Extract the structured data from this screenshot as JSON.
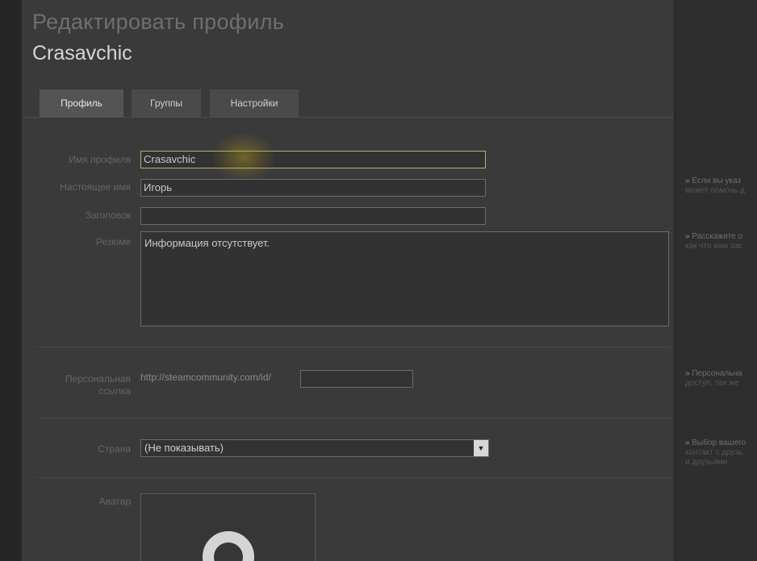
{
  "header": {
    "title": "Редактировать профиль",
    "username": "Crasavchic"
  },
  "tabs": [
    {
      "label": "Профиль",
      "active": true
    },
    {
      "label": "Группы",
      "active": false
    },
    {
      "label": "Настройки",
      "active": false
    }
  ],
  "form": {
    "profile_name": {
      "label": "Имя профиля",
      "value": "Crasavchic"
    },
    "real_name": {
      "label": "Настоящее имя",
      "value": "Игорь"
    },
    "headline": {
      "label": "Заголовок",
      "value": ""
    },
    "summary": {
      "label": "Резюме",
      "value": "Информация отсутствует."
    },
    "custom_url": {
      "label_line1": "Персональная",
      "label_line2": "ссылка",
      "prefix": "http://steamcommunity.com/id/",
      "value": ""
    },
    "country": {
      "label": "Страна",
      "selected": "(Не показывать)"
    },
    "avatar": {
      "label": "Аватар"
    }
  },
  "hints": [
    {
      "line1": "Если вы указ",
      "line2": "может помочь д"
    },
    {
      "line1": "Расскажите о",
      "line2": "как что вам зас"
    },
    {
      "line1": "Персональна",
      "line2": "доступ, так же"
    },
    {
      "line1": "Выбор вашего",
      "line2": "контакт с друзь",
      "line3": "и друзьями."
    }
  ],
  "icons": {
    "hint_bullet": "»",
    "select_arrow": "▼"
  },
  "colors": {
    "focus_border": "#bdb060",
    "background": "#3a3a3a"
  }
}
